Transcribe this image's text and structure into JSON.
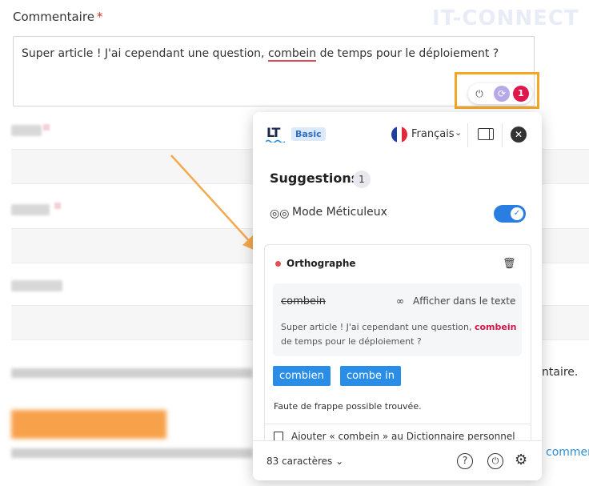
{
  "form": {
    "label": "Commentaire",
    "required_mark": "*",
    "watermark": "IT-CONNECT",
    "text_before": "Super article ! J'ai cependant une question, ",
    "text_error": "combein",
    "text_after": " de temps pour le déploiement ?"
  },
  "widget": {
    "power_glyph": "⏻",
    "sync_glyph": "⟳",
    "count": "1"
  },
  "background": {
    "right_text": "ntaire.",
    "right_link": "commen"
  },
  "panel": {
    "logo": "LT",
    "plan_badge": "Basic",
    "language": "Français",
    "suggestions_title": "Suggestions",
    "suggestions_count": "1",
    "mode_label": "Mode Méticuleux",
    "mode_enabled": true,
    "card": {
      "category": "Orthographe",
      "original_word": "combein",
      "show_in_text": "Afficher dans le texte",
      "context_before": "Super article ! J'ai cependant une question, ",
      "context_highlight": "combein",
      "context_after": " de temps pour le déploiement ?",
      "suggestions": [
        "combien",
        "combe in"
      ],
      "description": "Faute de frappe possible trouvée.",
      "add_to_dictionary": "Ajouter « combein » au Dictionnaire personnel"
    },
    "footer": {
      "char_count": "83 caractères"
    },
    "colors": {
      "accent": "#2a8ee6",
      "error": "#e0174a",
      "highlight_orange": "#f5a623"
    }
  }
}
